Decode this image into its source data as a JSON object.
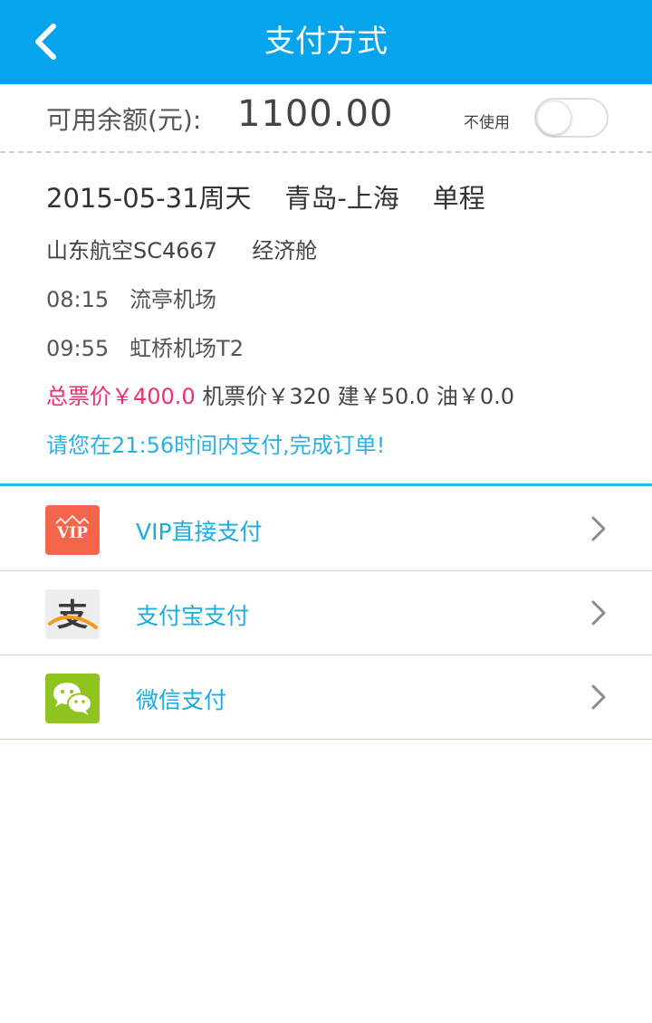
{
  "header": {
    "title": "支付方式",
    "back_icon": "chevron-left-icon"
  },
  "balance": {
    "label": "可用余额(元):",
    "amount": "1100.00",
    "toggle_label": "不使用",
    "toggle_on": false
  },
  "order": {
    "date_line": "2015-05-31周天    青岛-上海    单程",
    "flight_line": "山东航空SC4667     经济舱",
    "departure": {
      "time": "08:15",
      "airport": "流亭机场"
    },
    "arrival": {
      "time": "09:55",
      "airport": "虹桥机场T2"
    },
    "total_price": "总票价￥400.0",
    "price_breakdown": " 机票价￥320 建￥50.0 油￥0.0",
    "deadline": "请您在21:56时间内支付,完成订单!"
  },
  "payment_methods": [
    {
      "label": "VIP直接支付",
      "icon": "vip-icon",
      "icon_text": "VIP"
    },
    {
      "label": "支付宝支付",
      "icon": "alipay-icon",
      "icon_text": "支"
    },
    {
      "label": "微信支付",
      "icon": "wechat-icon"
    }
  ],
  "colors": {
    "header": "#07a4ee",
    "accent_blue": "#1dabe0",
    "price_pink": "#ee2e6e",
    "vip": "#f4664b",
    "wechat": "#8fc31f"
  }
}
